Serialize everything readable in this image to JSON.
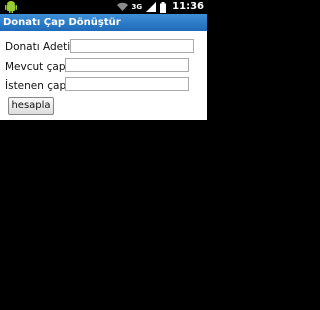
{
  "status_bar": {
    "network": "3G",
    "time": "11:36"
  },
  "app": {
    "title": "Donatı Çap Dönüştür"
  },
  "form": {
    "fields": [
      {
        "label": "Donatı Adeti:",
        "value": ""
      },
      {
        "label": "Mevcut çap:",
        "value": ""
      },
      {
        "label": "İstenen çap:",
        "value": ""
      }
    ],
    "button_label": "hesapla"
  },
  "colors": {
    "title_bar": "#2a7bc8",
    "background": "#000000",
    "form_background": "#ffffff"
  }
}
